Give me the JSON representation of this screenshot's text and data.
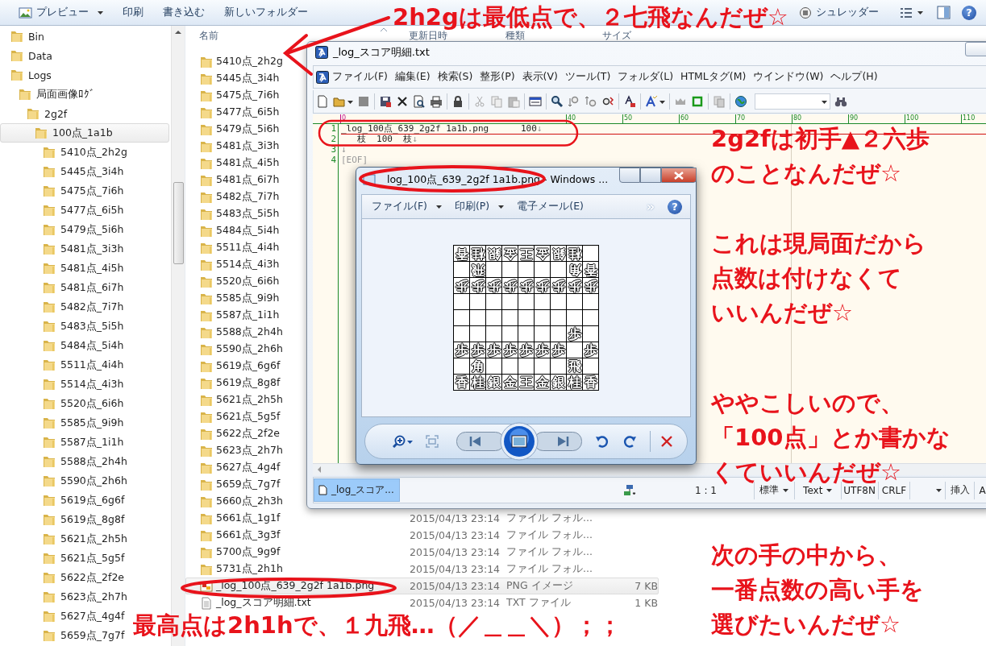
{
  "explorer": {
    "toolbar": {
      "items": [
        {
          "label": "プレビュー",
          "dropdown": true
        },
        {
          "label": "印刷",
          "dropdown": false
        },
        {
          "label": "書き込む",
          "dropdown": false
        },
        {
          "label": "新しいフォルダー",
          "dropdown": false
        }
      ],
      "shredder": "シュレッダー",
      "help": "?"
    },
    "tree": [
      {
        "label": "Bin",
        "selected": false
      },
      {
        "label": "Data",
        "selected": false
      },
      {
        "label": "Logs",
        "selected": false,
        "children": [
          {
            "label": "局面画像ﾛｸﾞ",
            "selected": false,
            "children": [
              {
                "label": "2g2f",
                "selected": false,
                "children": [
                  {
                    "label": "100点_1a1b",
                    "selected": true,
                    "children": [
                      {
                        "label": "5410点_2h2g",
                        "selected": false
                      },
                      {
                        "label": "5445点_3i4h",
                        "selected": false
                      },
                      {
                        "label": "5475点_7i6h",
                        "selected": false
                      },
                      {
                        "label": "5477点_6i5h",
                        "selected": false
                      },
                      {
                        "label": "5479点_5i6h",
                        "selected": false
                      },
                      {
                        "label": "5481点_3i3h",
                        "selected": false
                      },
                      {
                        "label": "5481点_4i5h",
                        "selected": false
                      },
                      {
                        "label": "5481点_6i7h",
                        "selected": false
                      },
                      {
                        "label": "5482点_7i7h",
                        "selected": false
                      },
                      {
                        "label": "5483点_5i5h",
                        "selected": false
                      },
                      {
                        "label": "5484点_5i4h",
                        "selected": false
                      },
                      {
                        "label": "5511点_4i4h",
                        "selected": false
                      },
                      {
                        "label": "5514点_4i3h",
                        "selected": false
                      },
                      {
                        "label": "5520点_6i6h",
                        "selected": false
                      },
                      {
                        "label": "5585点_9i9h",
                        "selected": false
                      },
                      {
                        "label": "5587点_1i1h",
                        "selected": false
                      },
                      {
                        "label": "5588点_2h4h",
                        "selected": false
                      },
                      {
                        "label": "5590点_2h6h",
                        "selected": false
                      },
                      {
                        "label": "5619点_6g6f",
                        "selected": false
                      },
                      {
                        "label": "5619点_8g8f",
                        "selected": false
                      },
                      {
                        "label": "5621点_2h5h",
                        "selected": false
                      },
                      {
                        "label": "5621点_5g5f",
                        "selected": false
                      },
                      {
                        "label": "5622点_2f2e",
                        "selected": false
                      },
                      {
                        "label": "5623点_2h7h",
                        "selected": false
                      },
                      {
                        "label": "5627点_4g4f",
                        "selected": false
                      },
                      {
                        "label": "5659点_7g7f",
                        "selected": false
                      }
                    ]
                  }
                ]
              }
            ]
          }
        ]
      }
    ],
    "list": {
      "columns": [
        "名前",
        "更新日時",
        "種類",
        "サイズ"
      ],
      "rows": [
        {
          "kind": "folder",
          "name": "5410点_2h2g",
          "selected": false
        },
        {
          "kind": "folder",
          "name": "5445点_3i4h",
          "selected": false
        },
        {
          "kind": "folder",
          "name": "5475点_7i6h",
          "selected": false
        },
        {
          "kind": "folder",
          "name": "5477点_6i5h",
          "selected": false
        },
        {
          "kind": "folder",
          "name": "5479点_5i6h",
          "selected": false
        },
        {
          "kind": "folder",
          "name": "5481点_3i3h",
          "selected": false
        },
        {
          "kind": "folder",
          "name": "5481点_4i5h",
          "selected": false
        },
        {
          "kind": "folder",
          "name": "5481点_6i7h",
          "selected": false
        },
        {
          "kind": "folder",
          "name": "5482点_7i7h",
          "selected": false
        },
        {
          "kind": "folder",
          "name": "5483点_5i5h",
          "selected": false
        },
        {
          "kind": "folder",
          "name": "5484点_5i4h",
          "selected": false
        },
        {
          "kind": "folder",
          "name": "5511点_4i4h",
          "selected": false
        },
        {
          "kind": "folder",
          "name": "5514点_4i3h",
          "selected": false
        },
        {
          "kind": "folder",
          "name": "5520点_6i6h",
          "selected": false
        },
        {
          "kind": "folder",
          "name": "5585点_9i9h",
          "selected": false
        },
        {
          "kind": "folder",
          "name": "5587点_1i1h",
          "selected": false
        },
        {
          "kind": "folder",
          "name": "5588点_2h4h",
          "selected": false
        },
        {
          "kind": "folder",
          "name": "5590点_2h6h",
          "selected": false
        },
        {
          "kind": "folder",
          "name": "5619点_6g6f",
          "selected": false
        },
        {
          "kind": "folder",
          "name": "5619点_8g8f",
          "selected": false
        },
        {
          "kind": "folder",
          "name": "5621点_2h5h",
          "selected": false
        },
        {
          "kind": "folder",
          "name": "5621点_5g5f",
          "selected": false
        },
        {
          "kind": "folder",
          "name": "5622点_2f2e",
          "selected": false
        },
        {
          "kind": "folder",
          "name": "5623点_2h7h",
          "selected": false
        },
        {
          "kind": "folder",
          "name": "5627点_4g4f",
          "selected": false
        },
        {
          "kind": "folder",
          "name": "5659点_7g7f",
          "selected": false
        },
        {
          "kind": "folder",
          "name": "5660点_2h3h",
          "selected": false
        },
        {
          "kind": "folder",
          "name": "5661点_1g1f",
          "date": "2015/04/13 23:14",
          "type": "ファイル フォル...",
          "selected": false
        },
        {
          "kind": "folder",
          "name": "5661点_3g3f",
          "date": "2015/04/13 23:14",
          "type": "ファイル フォル...",
          "selected": false
        },
        {
          "kind": "folder",
          "name": "5700点_9g9f",
          "date": "2015/04/13 23:14",
          "type": "ファイル フォル...",
          "selected": false
        },
        {
          "kind": "folder",
          "name": "5731点_2h1h",
          "date": "2015/04/13 23:14",
          "type": "ファイル フォル...",
          "selected": false
        },
        {
          "kind": "image",
          "name": "_log_100点_639_2g2f 1a1b.png",
          "date": "2015/04/13 23:14",
          "type": "PNG イメージ",
          "size": "7 KB",
          "selected": true
        },
        {
          "kind": "text",
          "name": "_log_スコア明細.txt",
          "date": "2015/04/13 23:14",
          "type": "TXT ファイル",
          "size": "1 KB",
          "selected": false
        }
      ]
    }
  },
  "editor": {
    "title": "_log_スコア明細.txt",
    "menu": [
      "ファイル(F)",
      "編集(E)",
      "検索(S)",
      "整形(P)",
      "表示(V)",
      "ツール(T)",
      "フォルダ(L)",
      "HTMLタグ(M)",
      "ウインドウ(W)",
      "ヘルプ(H)"
    ],
    "ruler": [
      "0",
      "40",
      "50",
      "60",
      "70",
      "80",
      "90",
      "100",
      "110"
    ],
    "lines": [
      {
        "kind": "text",
        "number": "1",
        "text": "_log_100点_639_2g2f 1a1b.png      100",
        "eol": "↓",
        "cursor": true
      },
      {
        "kind": "text",
        "number": "2",
        "text": "   枝  100  枝",
        "eol": "↓",
        "cursor": false
      },
      {
        "kind": "text",
        "number": "3",
        "eol": "↓",
        "cursor": false
      },
      {
        "kind": "eof",
        "number": "4",
        "text": "[EOF]",
        "cursor": false
      }
    ],
    "tab": {
      "label": "_log_スコア...",
      "selected": true
    },
    "status": [
      {
        "text": "1 : 1",
        "dropdown": false
      },
      {
        "text": "標準",
        "dropdown": true
      },
      {
        "text": "Text",
        "dropdown": true
      },
      {
        "text": "UTF8N",
        "dropdown": false
      },
      {
        "text": "CRLF",
        "dropdown": false
      },
      {
        "dropdown": true
      },
      {
        "text": "挿入",
        "dropdown": false
      },
      {
        "text": "A",
        "dropdown": false
      }
    ]
  },
  "viewer": {
    "title": "log_100点_639_2g2f 1a1b.png - Windows ...",
    "menu": [
      {
        "label": "ファイル(F)",
        "dropdown": true
      },
      {
        "label": "印刷(P)",
        "dropdown": true
      },
      {
        "label": "電子メール(E)",
        "dropdown": false
      }
    ],
    "overflow": "»",
    "help": "?",
    "board": [
      [
        {
          "kind": "piece",
          "piece": "香",
          "upside_down": true
        },
        {
          "kind": "piece",
          "piece": "桂",
          "upside_down": true
        },
        {
          "kind": "piece",
          "piece": "銀",
          "upside_down": true
        },
        {
          "kind": "piece",
          "piece": "金",
          "upside_down": true
        },
        {
          "kind": "piece",
          "piece": "王",
          "upside_down": true
        },
        {
          "kind": "piece",
          "piece": "金",
          "upside_down": true
        },
        {
          "kind": "piece",
          "piece": "銀",
          "upside_down": true
        },
        {
          "kind": "piece",
          "piece": "桂",
          "upside_down": true
        },
        {
          "kind": "empty"
        }
      ],
      [
        {
          "kind": "empty"
        },
        {
          "kind": "piece",
          "piece": "飛",
          "upside_down": true
        },
        {
          "kind": "empty"
        },
        {
          "kind": "empty"
        },
        {
          "kind": "empty"
        },
        {
          "kind": "empty"
        },
        {
          "kind": "empty"
        },
        {
          "kind": "piece",
          "piece": "角",
          "upside_down": true
        },
        {
          "kind": "piece",
          "piece": "香",
          "upside_down": true
        }
      ],
      [
        {
          "kind": "piece",
          "piece": "歩",
          "upside_down": true
        },
        {
          "kind": "piece",
          "piece": "歩",
          "upside_down": true
        },
        {
          "kind": "piece",
          "piece": "歩",
          "upside_down": true
        },
        {
          "kind": "piece",
          "piece": "歩",
          "upside_down": true
        },
        {
          "kind": "piece",
          "piece": "歩",
          "upside_down": true
        },
        {
          "kind": "piece",
          "piece": "歩",
          "upside_down": true
        },
        {
          "kind": "piece",
          "piece": "歩",
          "upside_down": true
        },
        {
          "kind": "piece",
          "piece": "歩",
          "upside_down": true
        },
        {
          "kind": "piece",
          "piece": "歩",
          "upside_down": true
        }
      ],
      [
        {
          "kind": "empty"
        },
        {
          "kind": "empty"
        },
        {
          "kind": "empty"
        },
        {
          "kind": "empty"
        },
        {
          "kind": "empty"
        },
        {
          "kind": "empty"
        },
        {
          "kind": "empty"
        },
        {
          "kind": "empty"
        },
        {
          "kind": "empty"
        }
      ],
      [
        {
          "kind": "empty"
        },
        {
          "kind": "empty"
        },
        {
          "kind": "empty"
        },
        {
          "kind": "empty"
        },
        {
          "kind": "empty"
        },
        {
          "kind": "empty"
        },
        {
          "kind": "empty"
        },
        {
          "kind": "empty"
        },
        {
          "kind": "empty"
        }
      ],
      [
        {
          "kind": "empty"
        },
        {
          "kind": "empty"
        },
        {
          "kind": "empty"
        },
        {
          "kind": "empty"
        },
        {
          "kind": "empty"
        },
        {
          "kind": "empty"
        },
        {
          "kind": "empty"
        },
        {
          "kind": "piece",
          "piece": "歩",
          "upside_down": false
        },
        {
          "kind": "empty"
        }
      ],
      [
        {
          "kind": "piece",
          "piece": "歩",
          "upside_down": false
        },
        {
          "kind": "piece",
          "piece": "歩",
          "upside_down": false
        },
        {
          "kind": "piece",
          "piece": "歩",
          "upside_down": false
        },
        {
          "kind": "piece",
          "piece": "歩",
          "upside_down": false
        },
        {
          "kind": "piece",
          "piece": "歩",
          "upside_down": false
        },
        {
          "kind": "piece",
          "piece": "歩",
          "upside_down": false
        },
        {
          "kind": "piece",
          "piece": "歩",
          "upside_down": false
        },
        {
          "kind": "empty"
        },
        {
          "kind": "piece",
          "piece": "歩",
          "upside_down": false
        }
      ],
      [
        {
          "kind": "empty"
        },
        {
          "kind": "piece",
          "piece": "角",
          "upside_down": false
        },
        {
          "kind": "empty"
        },
        {
          "kind": "empty"
        },
        {
          "kind": "empty"
        },
        {
          "kind": "empty"
        },
        {
          "kind": "empty"
        },
        {
          "kind": "piece",
          "piece": "飛",
          "upside_down": false
        },
        {
          "kind": "empty"
        }
      ],
      [
        {
          "kind": "piece",
          "piece": "香",
          "upside_down": false
        },
        {
          "kind": "piece",
          "piece": "桂",
          "upside_down": false
        },
        {
          "kind": "piece",
          "piece": "銀",
          "upside_down": false
        },
        {
          "kind": "piece",
          "piece": "金",
          "upside_down": false
        },
        {
          "kind": "piece",
          "piece": "王",
          "upside_down": false
        },
        {
          "kind": "piece",
          "piece": "金",
          "upside_down": false
        },
        {
          "kind": "piece",
          "piece": "銀",
          "upside_down": false
        },
        {
          "kind": "piece",
          "piece": "桂",
          "upside_down": false
        },
        {
          "kind": "piece",
          "piece": "香",
          "upside_down": false
        }
      ]
    ]
  },
  "notes": [
    {
      "lines": [
        "2h2gは最低点で、２七飛なんだぜ☆"
      ]
    },
    {
      "lines": [
        "2g2fは初手▲２六歩",
        "のことなんだぜ☆"
      ]
    },
    {
      "lines": [
        "これは現局面だから",
        "点数は付けなくて",
        "いいんだぜ☆"
      ]
    },
    {
      "lines": [
        "ややこしいので、",
        "「100点」とか書かな",
        "くていいんだぜ☆"
      ]
    },
    {
      "lines": [
        "最高点は2h1hで、１九飛…（／＿＿＼）；；"
      ]
    },
    {
      "lines": [
        "次の手の中から、",
        "一番点数の高い手を",
        "選びたいんだぜ☆"
      ]
    }
  ]
}
